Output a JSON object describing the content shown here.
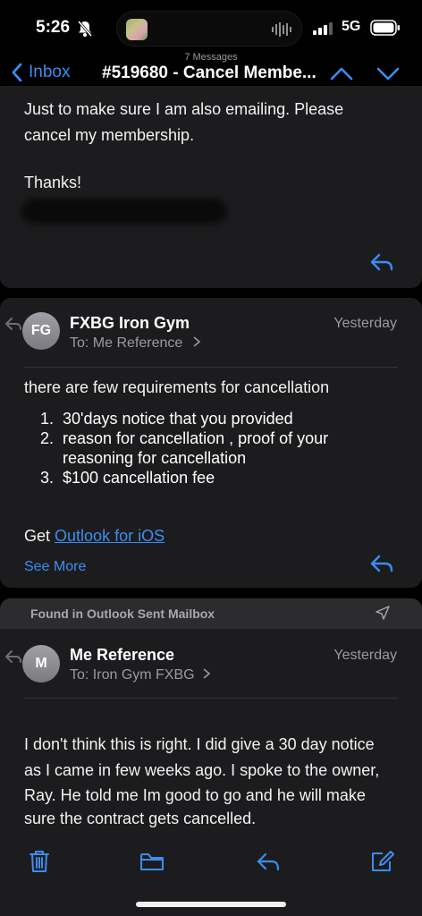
{
  "status": {
    "time": "5:26",
    "network": "5G"
  },
  "nav": {
    "back_label": "Inbox",
    "message_count": "7 Messages",
    "title": "#519680 - Cancel Membe..."
  },
  "message1": {
    "line1": "Just to make sure I am also emailing. Please",
    "line2": "cancel my membership.",
    "line3": "Thanks!"
  },
  "message2": {
    "avatar": "FG",
    "sender": "FXBG Iron Gym",
    "to_prefix": "To:",
    "to_name": "Me Reference",
    "date": "Yesterday",
    "intro": "there are few requirements for cancellation",
    "requirements": [
      {
        "num": "1.",
        "text": "30'days notice that you provided"
      },
      {
        "num": "2.",
        "text": "reason for cancellation , proof of your reasoning for cancellation"
      },
      {
        "num": "3.",
        "text": "$100 cancellation fee"
      }
    ],
    "get_label": "Get",
    "link_label": "Outlook for iOS",
    "see_more": "See More"
  },
  "found_bar": {
    "label": "Found in Outlook Sent Mailbox"
  },
  "message3": {
    "avatar": "M",
    "sender": "Me Reference",
    "to_prefix": "To:",
    "to_name": "Iron Gym FXBG",
    "date": "Yesterday",
    "line1": "I don't think this is right. I did give a 30 day notice",
    "line2": "as I came in few weeks ago. I spoke to the owner,",
    "line3": "Ray. He told me Im good to go and he will make",
    "line4": "sure the contract gets cancelled."
  },
  "colors": {
    "accent": "#3b8df4",
    "card": "#1c1c1e",
    "background": "#000000"
  }
}
